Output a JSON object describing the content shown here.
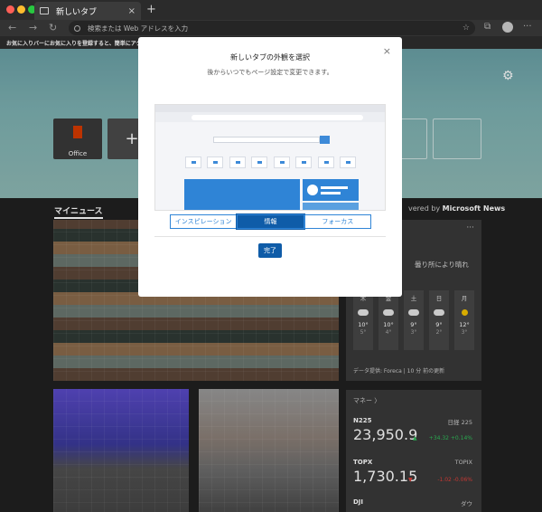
{
  "window": {
    "tab_title": "新しいタブ",
    "tab_close": "×",
    "new_tab": "+"
  },
  "navbar": {
    "back": "←",
    "forward": "→",
    "refresh": "↻",
    "address_placeholder": "検索または Web アドレスを入力",
    "favorite": "☆",
    "more": "···"
  },
  "favorites_bar": {
    "message": "お気に入りバーにお気に入りを登録すると、簡単にアクセスできます。"
  },
  "hero": {
    "settings": "⚙",
    "office_label": "Office",
    "add_tile": "+"
  },
  "feed": {
    "my_news": "マイニュース",
    "powered_prefix": "vered by ",
    "powered_brand": "Microsoft News"
  },
  "weather": {
    "more": "···",
    "description": "曇り所により晴れ",
    "days": [
      {
        "label": "木",
        "icon": "cloudy-icon",
        "high": "10°",
        "low": "5°"
      },
      {
        "label": "金",
        "icon": "rain-icon",
        "high": "10°",
        "low": "4°"
      },
      {
        "label": "土",
        "icon": "partly-sunny-icon",
        "high": "9°",
        "low": "3°"
      },
      {
        "label": "日",
        "icon": "partly-sunny-icon",
        "high": "9°",
        "low": "2°"
      },
      {
        "label": "月",
        "icon": "sunny-icon",
        "high": "12°",
        "low": "3°"
      }
    ],
    "source": "データ提供: Foreca | 10 分 前の更新"
  },
  "market": {
    "header": "マネー  〉",
    "items": [
      {
        "name": "N225",
        "alt": "日経 225",
        "value": "23,950.9",
        "direction": "▲",
        "change": "+34.32  +0.14%",
        "trend": "up"
      },
      {
        "name": "TOPX",
        "alt": "TOPIX",
        "value": "1,730.15",
        "direction": "▼",
        "change": "-1.02  -0.06%",
        "trend": "down"
      },
      {
        "name": "DJI",
        "alt": "ダウ",
        "value": "",
        "direction": "",
        "change": "",
        "trend": "up"
      }
    ]
  },
  "modal": {
    "close": "×",
    "title": "新しいタブの外観を選択",
    "subtitle": "後からいつでもページ設定で変更できます。",
    "options": [
      "インスピレーション",
      "情報",
      "フォーカス"
    ],
    "selected_option": "情報",
    "done": "完了"
  },
  "colors": {
    "accent": "#0f5ca8",
    "preview_blue": "#2f84d6",
    "office_red": "#d83b01"
  }
}
